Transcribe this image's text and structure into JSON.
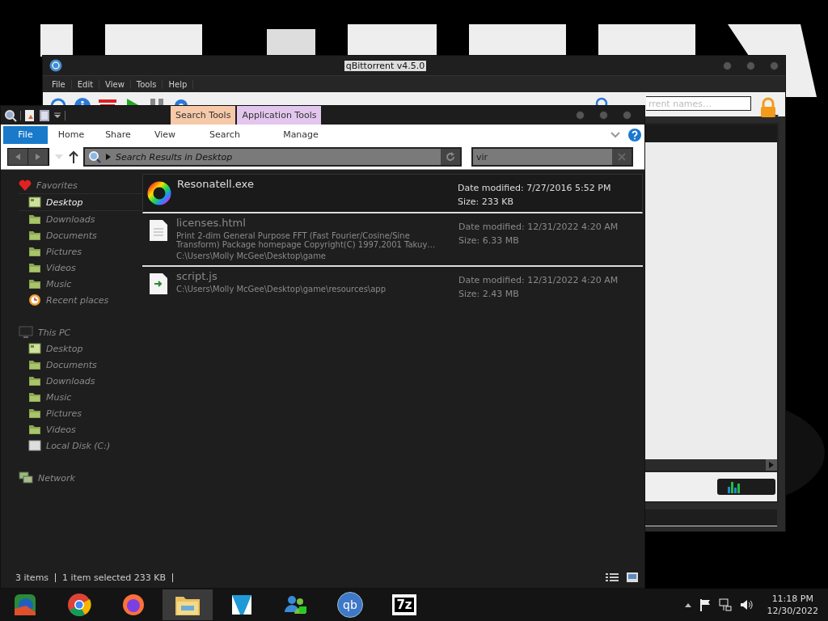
{
  "background_window": {
    "title": "qBittorrent v4.5.0",
    "menu": [
      "File",
      "Edit",
      "View",
      "Tools",
      "Help"
    ],
    "filter": {
      "placeholder": "rrent names…"
    }
  },
  "explorer": {
    "context_tabs": [
      {
        "label": "Search Tools",
        "color": "#f6c9a8"
      },
      {
        "label": "Application Tools",
        "color": "#e3c6ee"
      }
    ],
    "ribbon_tabs": [
      {
        "label": "File",
        "selected": true
      },
      {
        "label": "Home",
        "selected": false
      },
      {
        "label": "Share",
        "selected": false
      },
      {
        "label": "View",
        "selected": false
      },
      {
        "label": "Search",
        "selected": false
      },
      {
        "label": "Manage",
        "selected": false
      }
    ],
    "address": "Search Results in Desktop",
    "search": {
      "value": "vir"
    },
    "navigation": [
      {
        "label": "Favorites",
        "kind": "favorites",
        "children": [
          {
            "label": "Desktop",
            "kind": "desktop",
            "selected": true
          },
          {
            "label": "Downloads",
            "kind": "folder",
            "selected": false
          },
          {
            "label": "Documents",
            "kind": "folder",
            "selected": false
          },
          {
            "label": "Pictures",
            "kind": "folder",
            "selected": false
          },
          {
            "label": "Videos",
            "kind": "folder",
            "selected": false
          },
          {
            "label": "Music",
            "kind": "folder",
            "selected": false
          },
          {
            "label": "Recent places",
            "kind": "recent",
            "selected": false
          }
        ]
      },
      {
        "label": "This PC",
        "kind": "pc",
        "children": [
          {
            "label": "Desktop",
            "kind": "desktop",
            "selected": false
          },
          {
            "label": "Documents",
            "kind": "folder",
            "selected": false
          },
          {
            "label": "Downloads",
            "kind": "folder",
            "selected": false
          },
          {
            "label": "Music",
            "kind": "folder",
            "selected": false
          },
          {
            "label": "Pictures",
            "kind": "folder",
            "selected": false
          },
          {
            "label": "Videos",
            "kind": "folder",
            "selected": false
          },
          {
            "label": "Local Disk (C:)",
            "kind": "drive",
            "selected": false
          }
        ]
      },
      {
        "label": "Network",
        "kind": "network"
      }
    ],
    "results": [
      {
        "name": "Resonatell.exe",
        "kind": "exe",
        "selected": true,
        "date": "Date modified: 7/27/2016 5:52 PM",
        "size": "Size: 233 KB"
      },
      {
        "name": "licenses.html",
        "kind": "document",
        "selected": false,
        "description": "Print 2-dim General Purpose FFT (Fast Fourier/Cosine/Sine Transform) Package homepage Copyright(C) 1997,2001 Takuy…",
        "path": "C:\\Users\\Molly McGee\\Desktop\\game",
        "date": "Date modified: 12/31/2022 4:20 AM",
        "size": "Size: 6.33 MB"
      },
      {
        "name": "script.js",
        "kind": "script",
        "selected": false,
        "path": "C:\\Users\\Molly McGee\\Desktop\\game\\resources\\app",
        "date": "Date modified: 12/31/2022 4:20 AM",
        "size": "Size: 2.43 MB"
      }
    ],
    "status": [
      "3 items",
      "1 item selected  233 KB"
    ]
  },
  "taskbar": {
    "apps": [
      {
        "kind": "media",
        "selected": false
      },
      {
        "kind": "chrome",
        "selected": false
      },
      {
        "kind": "firefox",
        "selected": false
      },
      {
        "kind": "explorer",
        "selected": true
      },
      {
        "kind": "editor",
        "selected": false
      },
      {
        "kind": "people",
        "selected": false
      },
      {
        "kind": "qb",
        "label": "qb",
        "selected": false
      },
      {
        "kind": "zip",
        "label": "7z",
        "selected": false
      }
    ],
    "time": "11:18 PM",
    "date": "12/30/2022"
  }
}
